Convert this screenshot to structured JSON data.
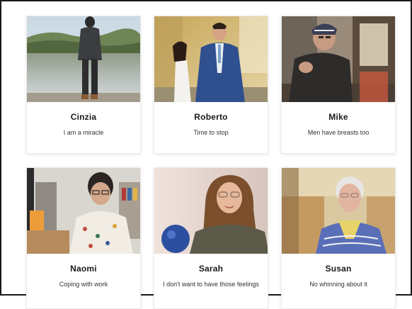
{
  "people": [
    {
      "name": "Cinzia",
      "tagline": "I am a miracle"
    },
    {
      "name": "Roberto",
      "tagline": "Time to stop"
    },
    {
      "name": "Mike",
      "tagline": "Men have breasts too"
    },
    {
      "name": "Naomi",
      "tagline": "Coping with work"
    },
    {
      "name": "Sarah",
      "tagline": "I don't want to have those feelings"
    },
    {
      "name": "Susan",
      "tagline": "No whinning about it"
    }
  ],
  "colors": {
    "frame_border": "#1a1a1a",
    "card_border": "#ececec",
    "name_text": "#1a1a1a",
    "tagline_text": "#333333"
  }
}
